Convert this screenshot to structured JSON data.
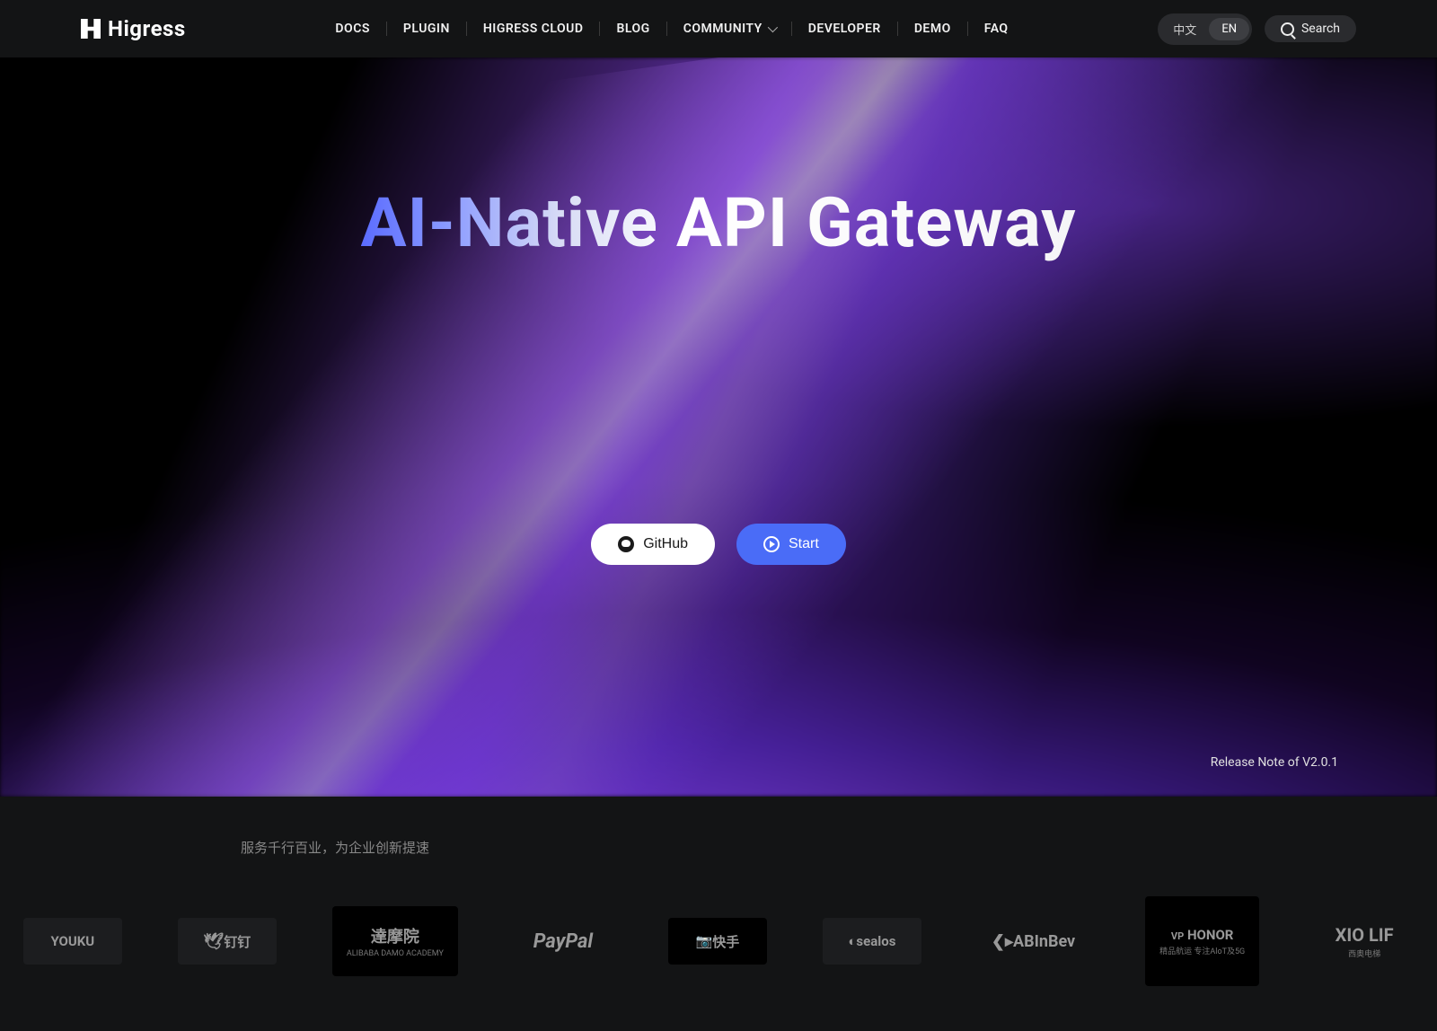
{
  "brand": "Higress",
  "nav": {
    "items": [
      {
        "label": "DOCS"
      },
      {
        "label": "PLUGIN"
      },
      {
        "label": "HIGRESS CLOUD"
      },
      {
        "label": "BLOG"
      },
      {
        "label": "COMMUNITY",
        "dropdown": true
      },
      {
        "label": "DEVELOPER"
      },
      {
        "label": "DEMO"
      },
      {
        "label": "FAQ"
      }
    ]
  },
  "lang": {
    "zh": "中文",
    "en": "EN"
  },
  "search": {
    "label": "Search"
  },
  "hero": {
    "title": "AI-Native API Gateway",
    "github_label": "GitHub",
    "start_label": "Start",
    "release_note": "Release Note of V2.0.1"
  },
  "partners": {
    "title": "服务千行百业，为企业创新提速",
    "logos": [
      {
        "name": "YOUKU"
      },
      {
        "name": "钉钉"
      },
      {
        "name": "達摩院",
        "sub": "ALIBABA DAMO ACADEMY"
      },
      {
        "name": "PayPal"
      },
      {
        "name": "快手"
      },
      {
        "name": "sealos"
      },
      {
        "name": "ABInBev"
      },
      {
        "name": "HONOR",
        "sub": "精品航运 专注AloT及5G"
      },
      {
        "name": "XIO LIF",
        "sub": "西奥电梯"
      }
    ]
  }
}
